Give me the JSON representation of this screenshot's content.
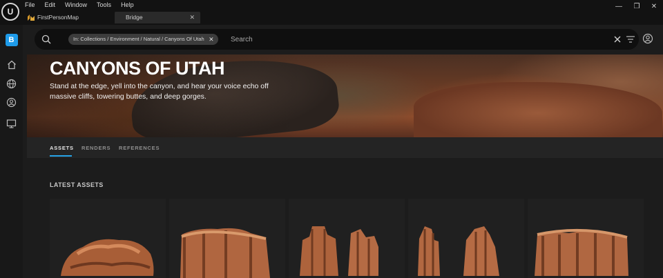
{
  "menu": [
    "File",
    "Edit",
    "Window",
    "Tools",
    "Help"
  ],
  "tabs": [
    {
      "label": "FirstPersonMap"
    },
    {
      "label": "Bridge",
      "close": "✕"
    }
  ],
  "window_controls": {
    "minimize": "—",
    "restore": "❐",
    "close": "✕"
  },
  "search": {
    "chip_label": "In: Collections / Environment / Natural / Canyons Of Utah",
    "chip_close": "✕",
    "placeholder": "Search",
    "clear": "✕"
  },
  "banner": {
    "title": "CANYONS OF UTAH",
    "description": "Stand at the edge, yell into the canyon, and hear your voice echo off massive cliffs, towering buttes, and deep gorges."
  },
  "section_tabs": [
    {
      "label": "ASSETS",
      "active": true
    },
    {
      "label": "RENDERS",
      "active": false
    },
    {
      "label": "REFERENCES",
      "active": false
    }
  ],
  "latest_assets_title": "LATEST ASSETS",
  "colors": {
    "accent": "#27a5e8",
    "bridge_icon": "#1e9be9",
    "rock": "#b5653c"
  },
  "icons": [
    "ue-logo",
    "bridge-icon",
    "home-icon",
    "globe-icon",
    "user-circle-icon",
    "monitor-icon",
    "search-icon",
    "filter-icon",
    "account-icon"
  ]
}
